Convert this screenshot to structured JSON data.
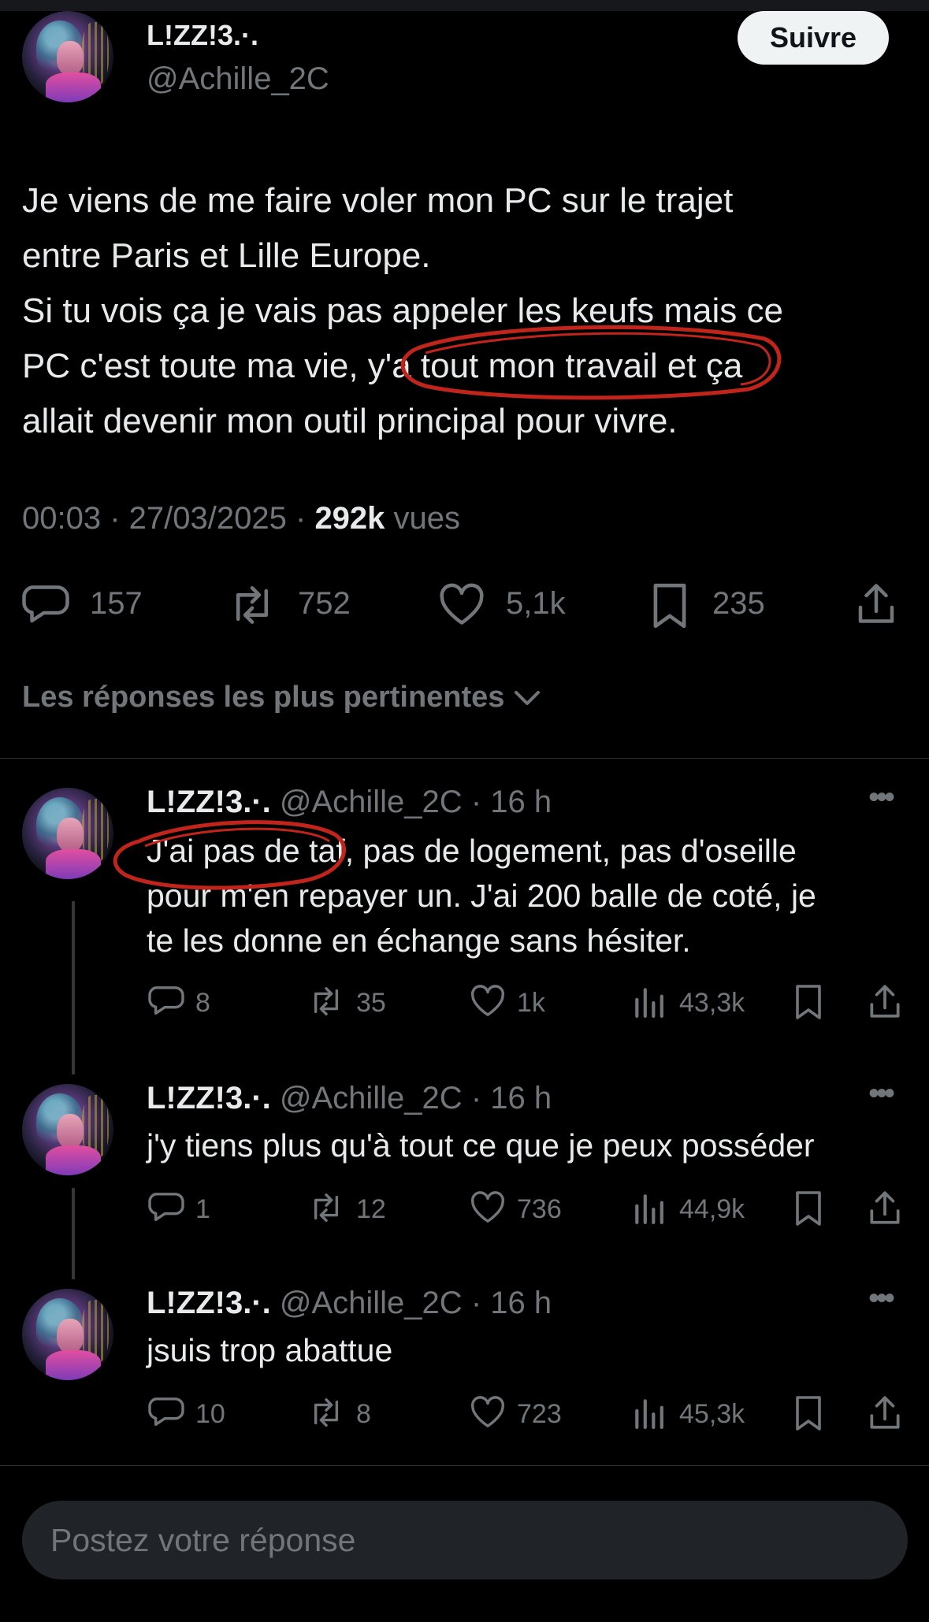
{
  "tweet": {
    "display_name": "L!ZZ!3.·.",
    "handle": "@Achille_2C",
    "follow_label": "Suivre",
    "text_lines": [
      "Je viens de me faire voler mon PC sur le trajet",
      "entre Paris et Lille Europe.",
      "Si tu vois ça je vais pas appeler les keufs mais ce",
      "PC c'est toute ma vie, y'a tout mon travail et ça",
      "allait devenir mon outil principal pour vivre."
    ],
    "time": "00:03",
    "date": "27/03/2025",
    "views_count": "292k",
    "views_label": "vues",
    "stats": {
      "replies": "157",
      "reposts": "752",
      "likes": "5,1k",
      "bookmarks": "235"
    }
  },
  "replies_header": "Les réponses les plus pertinentes",
  "replies": [
    {
      "name": "L!ZZ!3.·.",
      "handle": "@Achille_2C",
      "age": "16 h",
      "text_lines": [
        "J'ai pas de taf, pas de logement, pas d'oseille",
        "pour m'en repayer un. J'ai 200 balle de coté, je",
        "te les donne en échange sans hésiter."
      ],
      "replies": "8",
      "reposts": "35",
      "likes": "1k",
      "views": "43,3k"
    },
    {
      "name": "L!ZZ!3.·.",
      "handle": "@Achille_2C",
      "age": "16 h",
      "text_lines": [
        "j'y tiens plus qu'à tout ce que je peux posséder"
      ],
      "replies": "1",
      "reposts": "12",
      "likes": "736",
      "views": "44,9k"
    },
    {
      "name": "L!ZZ!3.·.",
      "handle": "@Achille_2C",
      "age": "16 h",
      "text_lines": [
        "jsuis trop abattue"
      ],
      "replies": "10",
      "reposts": "8",
      "likes": "723",
      "views": "45,3k"
    }
  ],
  "reply_input": {
    "placeholder": "Postez votre réponse"
  },
  "colors": {
    "background": "#000000",
    "text": "#e7e9ea",
    "muted": "#71767b",
    "divider": "#2f3336",
    "annotation": "#c0241b"
  }
}
